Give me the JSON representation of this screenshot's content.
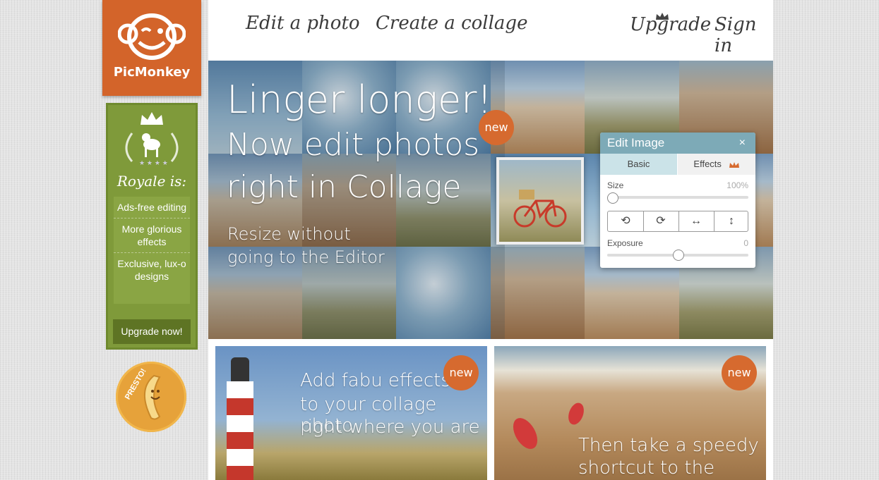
{
  "brand": {
    "name": "PicMonkey"
  },
  "nav": {
    "edit": "Edit a photo",
    "collage": "Create a collage",
    "upgrade": "Upgrade",
    "signin": "Sign in"
  },
  "royale": {
    "title": "Royale is:",
    "perks": [
      "Ads-free editing",
      "More glorious effects",
      "Exclusive, lux-o designs"
    ],
    "cta": "Upgrade now!"
  },
  "presto": {
    "label": "PRESTO!"
  },
  "hero": {
    "line1": "Linger longer!",
    "line2": "Now edit photos",
    "line3": "right in Collage",
    "sub1": "Resize without",
    "sub2": "going to the Editor",
    "badge": "new"
  },
  "panel": {
    "title": "Edit Image",
    "close": "×",
    "tab_basic": "Basic",
    "tab_effects": "Effects",
    "size_label": "Size",
    "size_value": "100%",
    "exposure_label": "Exposure",
    "exposure_value": "0",
    "tools": [
      "rotate-left-icon",
      "rotate-right-icon",
      "flip-horizontal-icon",
      "flip-vertical-icon"
    ]
  },
  "card1": {
    "line1": "Add fabu effects",
    "line2": "to your collage photo",
    "line3": "right where you are",
    "badge": "new"
  },
  "card2": {
    "line1": "Then take a speedy",
    "line2": "shortcut to the Editor",
    "badge": "new"
  },
  "colors": {
    "brand_orange": "#d3642a",
    "royale_green": "#7f9a3a",
    "panel_header": "#7daab7"
  }
}
